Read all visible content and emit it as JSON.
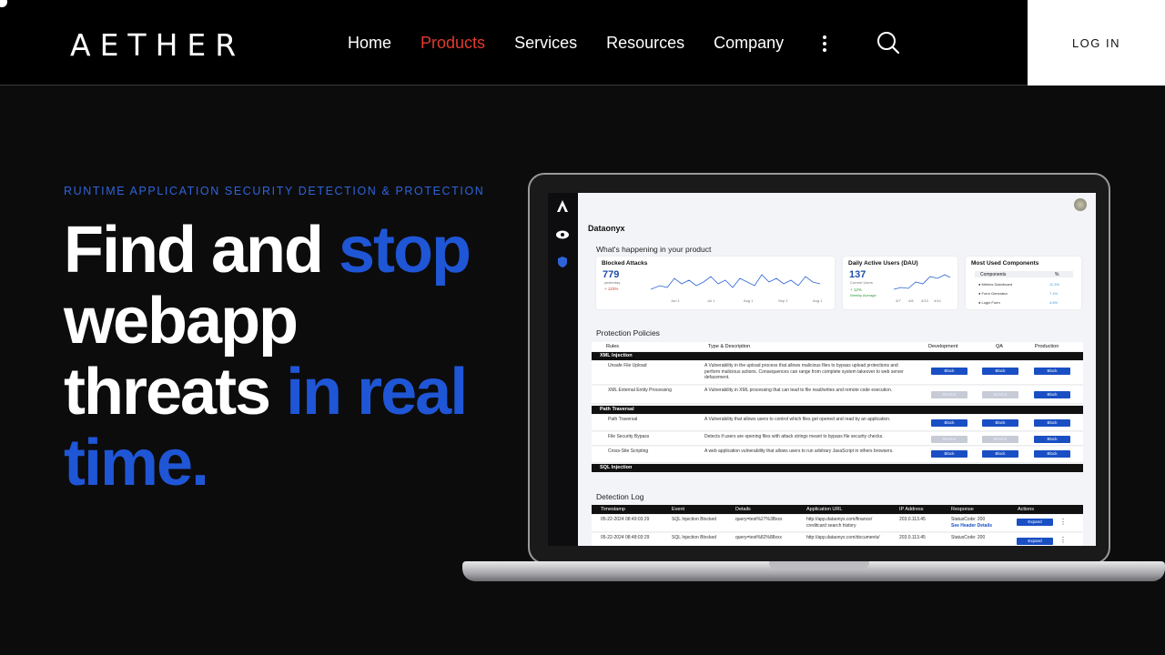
{
  "nav": {
    "logo": "AETHER",
    "items": [
      "Home",
      "Products",
      "Services",
      "Resources",
      "Company"
    ],
    "active_index": 1,
    "login": "LOG IN",
    "search_icon": "search-icon",
    "more_icon": "kebab-icon"
  },
  "hero": {
    "eyebrow": "RUNTIME APPLICATION SECURITY DETECTION & PROTECTION",
    "line1_white": "Find and ",
    "line1_blue": "stop",
    "line2": "webapp",
    "line3_white": "threats ",
    "line3_blue": "in real",
    "line4_blue": "time."
  },
  "colors": {
    "accent": "#1f56d6",
    "active_nav": "#e23b2e",
    "background": "#0c0c0d"
  },
  "dashboard": {
    "app_name": "Dataonyx",
    "whats_happening": "What's happening in your product",
    "blocked": {
      "title": "Blocked Attacks",
      "value": "779",
      "sub": "yesterday",
      "delta": "+ 123%",
      "x_ticks": [
        "Jun 1",
        "Jul 1",
        "Aug 1",
        "Sep 1",
        "Aug 1"
      ]
    },
    "dau": {
      "title": "Daily Active Users (DAU)",
      "value": "137",
      "sub": "Current Users",
      "delta": "+ 12%",
      "delta_sub": "Weekly Average",
      "x_ticks": [
        "4/7",
        "4/8",
        "4/13",
        "4/14"
      ]
    },
    "components": {
      "title": "Most Used Components",
      "col1": "Components",
      "col2": "%",
      "rows": [
        [
          "Metrics Dashboard",
          "11.3%"
        ],
        [
          "Form Generator",
          "7.1%"
        ],
        [
          "Login Form",
          "4.6%"
        ]
      ]
    },
    "policies": {
      "title": "Protection Policies",
      "headers": [
        "Rules",
        "Type & Description",
        "Development",
        "QA",
        "Production"
      ],
      "groups": [
        {
          "name": "XML Injection",
          "rows": [
            {
              "rule": "Unsafe File Upload",
              "desc": "A Vulnerability in the upload process that allows malicious files to bypass upload protections and perform malicious actions. Consequences can range from complete system takeover to web server defacement.",
              "dev": "Block",
              "qa": "Block",
              "prod": "Block"
            },
            {
              "rule": "XML External Entity Processing",
              "desc": "A Vulnerability in XML processing that can lead to file read/writes and remote code execution.",
              "dev": "Monitor",
              "qa": "Monitor",
              "prod": "Block"
            }
          ]
        },
        {
          "name": "Path Traversal",
          "rows": [
            {
              "rule": "Path Traversal",
              "desc": "A Vulnerability that allows users to control which files get opened and read by an application.",
              "dev": "Block",
              "qa": "Block",
              "prod": "Block"
            },
            {
              "rule": "File Security Bypass",
              "desc": "Detects if users are opening files with attack strings meant to bypass file security checks.",
              "dev": "Monitor",
              "qa": "Monitor",
              "prod": "Block"
            },
            {
              "rule": "Cross-Site Scripting",
              "desc": "A web application vulnerability that allows users to run arbitrary JavaScript in others browsers.",
              "dev": "Block",
              "qa": "Block",
              "prod": "Block"
            }
          ]
        },
        {
          "name": "SQL Injection",
          "rows": []
        }
      ]
    },
    "log": {
      "title": "Detection Log",
      "headers": [
        "Timestamp",
        "Event",
        "Details",
        "Application URL",
        "IP Address",
        "Response",
        "Actions"
      ],
      "rows": [
        {
          "ts": "05-22-2024 08:49:03:29",
          "event": "SQL Injection Blocked",
          "details": "query=test%27%3Bxxx",
          "url": "http://app.dataonyx.com/finance/ creditcard search history",
          "ip": "203.0.113.45",
          "resp": "StatusCode: 200",
          "resp2": "See Header Details",
          "action": "Expand"
        },
        {
          "ts": "05-22-2024 08:48:03:29",
          "event": "SQL Injection Blocked",
          "details": "query=test%82%88xxx",
          "url": "http://app.dataonyx.com/documents/",
          "ip": "203.0.113.45",
          "resp": "StatusCode: 200",
          "resp2": "",
          "action": "Expand"
        }
      ]
    }
  }
}
